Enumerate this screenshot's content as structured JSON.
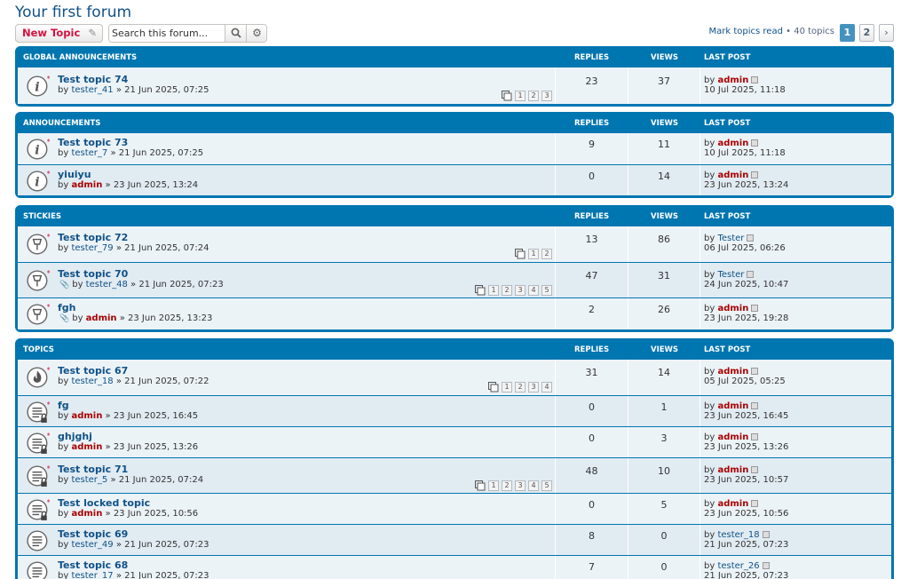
{
  "forum_title": "Your first forum",
  "actions": {
    "new_topic": "New Topic",
    "search_placeholder": "Search this forum…",
    "search_value": "Search this forum...",
    "mark_read": "Mark topics read",
    "separator": " • ",
    "topic_count": "40 topics",
    "pages": [
      "1",
      "2"
    ],
    "next": "›"
  },
  "columns": {
    "replies": "Replies",
    "views": "Views",
    "last_post": "Last post"
  },
  "colors": {
    "brand_blue": "#0076b1",
    "link": "#105289",
    "admin": "#aa0000",
    "new_topic": "#d31141"
  },
  "sections": [
    {
      "title": "Global Announcements",
      "topics": [
        {
          "icon": "announce-icon",
          "title": "Test topic 74",
          "author": "tester_41",
          "author_admin": false,
          "date": "21 Jun 2025, 07:25",
          "attach": false,
          "pages": [
            "1",
            "2",
            "3"
          ],
          "replies": "23",
          "views": "37",
          "last_by": "admin",
          "last_admin": true,
          "last_date": "10 Jul 2025, 11:18"
        }
      ]
    },
    {
      "title": "Announcements",
      "topics": [
        {
          "icon": "announce-icon",
          "title": "Test topic 73",
          "author": "tester_7",
          "author_admin": false,
          "date": "21 Jun 2025, 07:25",
          "attach": false,
          "pages": [],
          "replies": "9",
          "views": "11",
          "last_by": "admin",
          "last_admin": true,
          "last_date": "10 Jul 2025, 11:18"
        },
        {
          "icon": "announce-icon",
          "title": "yiuiyu",
          "author": "admin",
          "author_admin": true,
          "date": "23 Jun 2025, 13:24",
          "attach": false,
          "pages": [],
          "replies": "0",
          "views": "14",
          "last_by": "admin",
          "last_admin": true,
          "last_date": "23 Jun 2025, 13:24"
        }
      ]
    },
    {
      "title": "Stickies",
      "topics": [
        {
          "icon": "sticky-icon",
          "title": "Test topic 72",
          "author": "tester_79",
          "author_admin": false,
          "date": "21 Jun 2025, 07:24",
          "attach": false,
          "pages": [
            "1",
            "2"
          ],
          "replies": "13",
          "views": "86",
          "last_by": "Tester",
          "last_admin": false,
          "last_date": "06 Jul 2025, 06:26"
        },
        {
          "icon": "sticky-icon",
          "title": "Test topic 70",
          "author": "tester_48",
          "author_admin": false,
          "date": "21 Jun 2025, 07:23",
          "attach": true,
          "pages": [
            "1",
            "2",
            "3",
            "4",
            "5"
          ],
          "replies": "47",
          "views": "31",
          "last_by": "Tester",
          "last_admin": false,
          "last_date": "24 Jun 2025, 10:47"
        },
        {
          "icon": "sticky-icon",
          "title": "fgh",
          "author": "admin",
          "author_admin": true,
          "date": "23 Jun 2025, 13:23",
          "attach": true,
          "pages": [],
          "replies": "2",
          "views": "26",
          "last_by": "admin",
          "last_admin": true,
          "last_date": "23 Jun 2025, 19:28"
        }
      ]
    },
    {
      "title": "Topics",
      "topics": [
        {
          "icon": "hot-topic-icon",
          "title": "Test topic 67",
          "author": "tester_18",
          "author_admin": false,
          "date": "21 Jun 2025, 07:22",
          "attach": false,
          "pages": [
            "1",
            "2",
            "3",
            "4"
          ],
          "replies": "31",
          "views": "14",
          "last_by": "admin",
          "last_admin": true,
          "last_date": "05 Jul 2025, 05:25"
        },
        {
          "icon": "locked-topic-icon",
          "title": "fg",
          "author": "admin",
          "author_admin": true,
          "date": "23 Jun 2025, 16:45",
          "attach": false,
          "pages": [],
          "replies": "0",
          "views": "1",
          "last_by": "admin",
          "last_admin": true,
          "last_date": "23 Jun 2025, 16:45"
        },
        {
          "icon": "locked-topic-icon",
          "title": "ghjghj",
          "author": "admin",
          "author_admin": true,
          "date": "23 Jun 2025, 13:26",
          "attach": false,
          "pages": [],
          "replies": "0",
          "views": "3",
          "last_by": "admin",
          "last_admin": true,
          "last_date": "23 Jun 2025, 13:26"
        },
        {
          "icon": "locked-topic-icon",
          "title": "Test topic 71",
          "author": "tester_5",
          "author_admin": false,
          "date": "21 Jun 2025, 07:24",
          "attach": false,
          "pages": [
            "1",
            "2",
            "3",
            "4",
            "5"
          ],
          "replies": "48",
          "views": "10",
          "last_by": "admin",
          "last_admin": true,
          "last_date": "23 Jun 2025, 10:57"
        },
        {
          "icon": "locked-topic-icon",
          "title": "Test locked topic",
          "author": "admin",
          "author_admin": true,
          "date": "23 Jun 2025, 10:56",
          "attach": false,
          "pages": [],
          "replies": "0",
          "views": "5",
          "last_by": "admin",
          "last_admin": true,
          "last_date": "23 Jun 2025, 10:56"
        },
        {
          "icon": "topic-icon",
          "title": "Test topic 69",
          "author": "tester_49",
          "author_admin": false,
          "date": "21 Jun 2025, 07:23",
          "attach": false,
          "pages": [],
          "replies": "8",
          "views": "0",
          "last_by": "tester_18",
          "last_admin": false,
          "last_date": "21 Jun 2025, 07:23"
        },
        {
          "icon": "topic-icon",
          "title": "Test topic 68",
          "author": "tester_17",
          "author_admin": false,
          "date": "21 Jun 2025, 07:23",
          "attach": false,
          "pages": [],
          "replies": "7",
          "views": "0",
          "last_by": "tester_26",
          "last_admin": false,
          "last_date": "21 Jun 2025, 07:23"
        }
      ]
    }
  ]
}
